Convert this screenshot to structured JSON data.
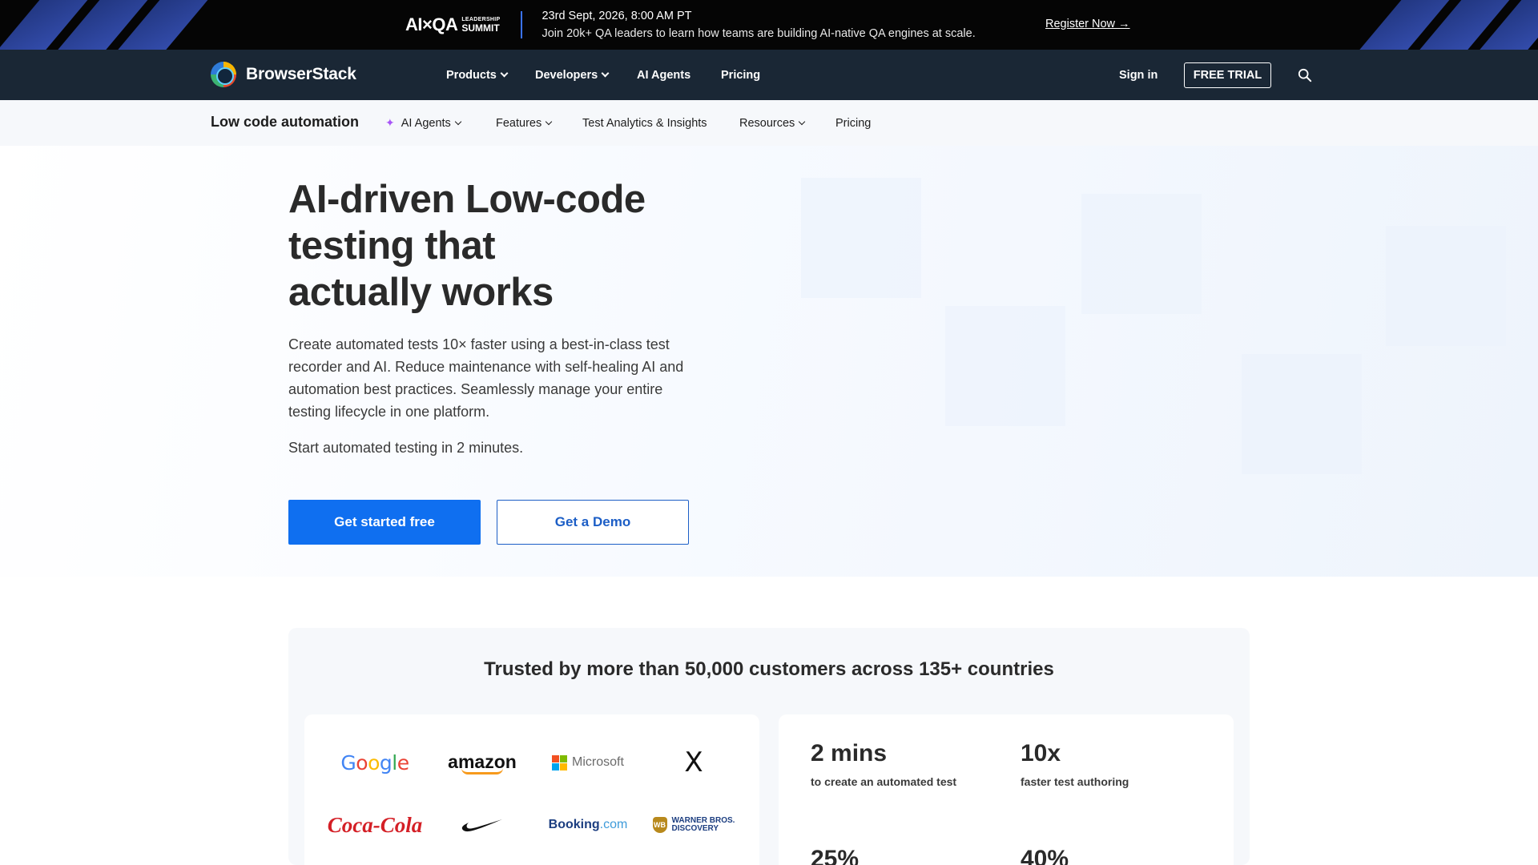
{
  "promo": {
    "logo_main": "AI×QA",
    "logo_top": "LEADERSHIP",
    "logo_bottom": "SUMMIT",
    "date": "23rd Sept, 2026, 8:00 AM PT",
    "subtitle": "Join 20k+ QA leaders to learn how teams are building AI-native QA engines at scale.",
    "register": "Register Now →"
  },
  "nav": {
    "brand": "BrowserStack",
    "items": [
      "Products",
      "Developers",
      "AI Agents",
      "Pricing"
    ],
    "sign_in": "Sign in",
    "free_trial": "FREE TRIAL"
  },
  "subnav": {
    "title": "Low code automation",
    "items": [
      "AI Agents",
      "Features",
      "Test Analytics & Insights",
      "Resources",
      "Pricing"
    ]
  },
  "hero": {
    "title_line1": "AI-driven Low-code",
    "title_line2": "testing that",
    "title_line3": "actually works",
    "description": "Create automated tests 10× faster using a best-in-class test recorder and AI. Reduce maintenance with self-healing AI and automation best practices. Seamlessly manage your entire testing lifecycle in one platform.",
    "start_text": "Start automated testing in 2 minutes.",
    "primary_cta": "Get started free",
    "secondary_cta": "Get a Demo"
  },
  "trust": {
    "title": "Trusted by more than 50,000 customers across 135+ countries",
    "logos": {
      "google": "Google",
      "amazon": "amazon",
      "microsoft": "Microsoft",
      "x": "X",
      "cocacola": "Coca-Cola",
      "nike": "Nike",
      "booking_main": "Booking",
      "booking_suffix": ".com",
      "wb_line1": "WARNER BROS.",
      "wb_line2": "DISCOVERY"
    },
    "stats": [
      {
        "value": "2 mins",
        "label": "to create an automated test"
      },
      {
        "value": "10x",
        "label": "faster test authoring"
      },
      {
        "value": "25%",
        "label": ""
      },
      {
        "value": "40%",
        "label": ""
      }
    ]
  },
  "colors": {
    "accent": "#0f6ff0",
    "nav_bg": "#1a2735",
    "promo_bg": "#050505"
  }
}
